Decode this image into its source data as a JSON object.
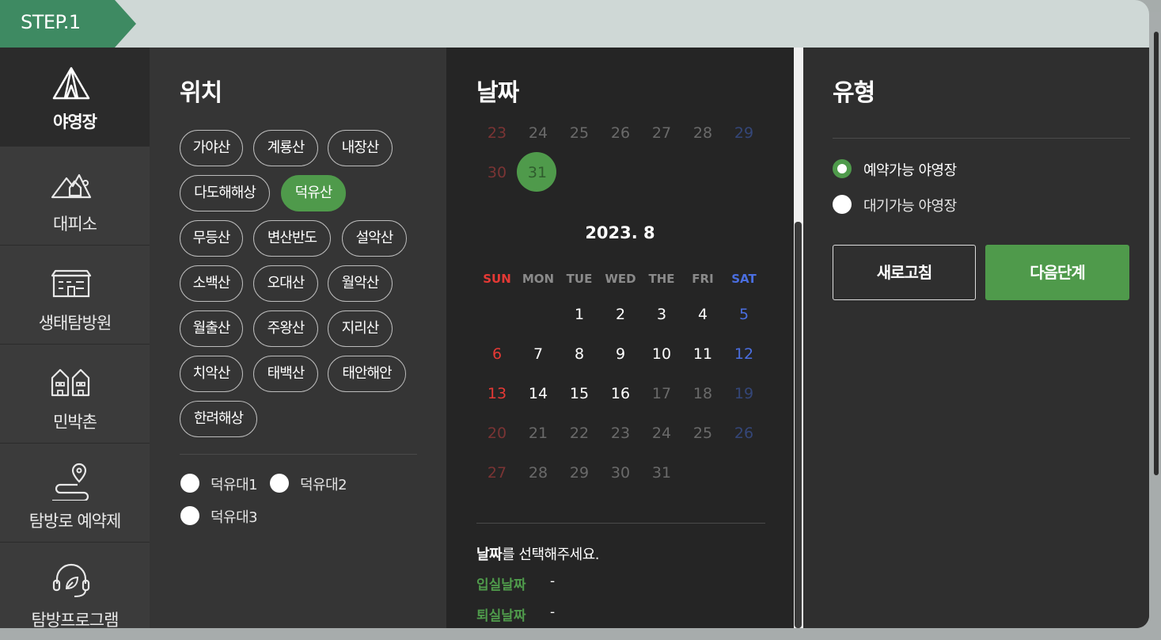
{
  "step": {
    "label": "STEP.1"
  },
  "sidebar": {
    "items": [
      {
        "label": "야영장",
        "icon": "tent-icon"
      },
      {
        "label": "대피소",
        "icon": "mountain-shelter-icon"
      },
      {
        "label": "생태탐방원",
        "icon": "building-icon"
      },
      {
        "label": "민박촌",
        "icon": "houses-icon"
      },
      {
        "label": "탐방로 예약제",
        "icon": "trail-pin-icon"
      },
      {
        "label": "탐방프로그램",
        "icon": "headset-leaf-icon"
      }
    ]
  },
  "location": {
    "title": "위치",
    "chips": [
      "가야산",
      "계룡산",
      "내장산",
      "다도해해상",
      "덕유산",
      "무등산",
      "변산반도",
      "설악산",
      "소백산",
      "오대산",
      "월악산",
      "월출산",
      "주왕산",
      "지리산",
      "치악산",
      "태백산",
      "태안해안",
      "한려해상"
    ],
    "selected": "덕유산",
    "sub_options": [
      "덕유대1",
      "덕유대2",
      "덕유대3"
    ]
  },
  "date": {
    "title": "날짜",
    "prev_month_tail": {
      "row1": [
        "23",
        "24",
        "25",
        "26",
        "27",
        "28",
        "29"
      ],
      "row2": [
        "30",
        "31"
      ]
    },
    "selected_day": "31",
    "month_title": "2023. 8",
    "weekdays": [
      "SUN",
      "MON",
      "TUE",
      "WED",
      "THE",
      "FRI",
      "SAT"
    ],
    "weeks": [
      [
        "",
        "",
        "1",
        "2",
        "3",
        "4",
        "5"
      ],
      [
        "6",
        "7",
        "8",
        "9",
        "10",
        "11",
        "12"
      ],
      [
        "13",
        "14",
        "15",
        "16",
        "17",
        "18",
        "19"
      ],
      [
        "20",
        "21",
        "22",
        "23",
        "24",
        "25",
        "26"
      ],
      [
        "27",
        "28",
        "29",
        "30",
        "31",
        "",
        ""
      ]
    ],
    "enabled_through": "16",
    "prompt_bold": "날짜",
    "prompt_rest": "를 선택해주세요.",
    "checkin_label": "입실날짜",
    "checkin_value": "-",
    "checkout_label": "퇴실날짜",
    "checkout_value": "-"
  },
  "type": {
    "title": "유형",
    "options": [
      {
        "label": "예약가능 야영장",
        "selected": true
      },
      {
        "label": "대기가능 야영장",
        "selected": false
      }
    ],
    "refresh_label": "새로고침",
    "next_label": "다음단계"
  },
  "colors": {
    "accent": "#4f9a4b",
    "step": "#3e8a62",
    "sunday": "#e53935",
    "saturday": "#4a6ee0"
  }
}
